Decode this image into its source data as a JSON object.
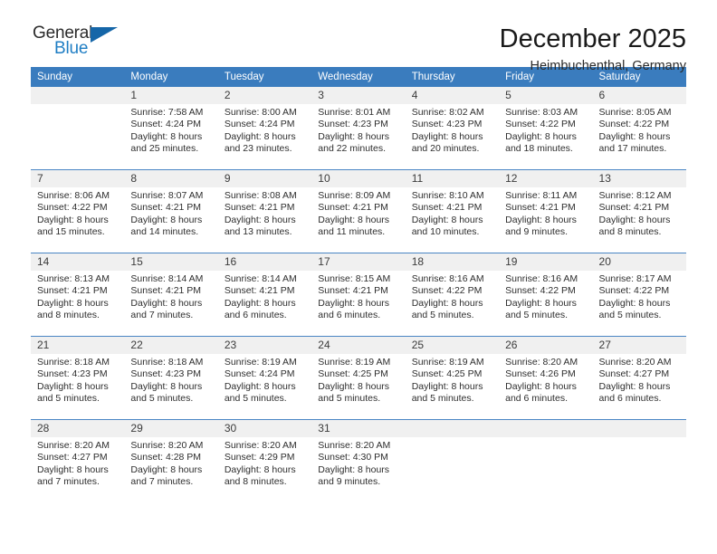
{
  "brand": {
    "name_primary": "General",
    "name_secondary": "Blue"
  },
  "header": {
    "title": "December 2025",
    "location": "Heimbuchenthal, Germany"
  },
  "colors": {
    "header_blue": "#3a7cbe",
    "logo_blue": "#1f7ec4",
    "row_divider": "#4a86c4",
    "daynum_band": "#f0f0f0"
  },
  "weekdays": [
    "Sunday",
    "Monday",
    "Tuesday",
    "Wednesday",
    "Thursday",
    "Friday",
    "Saturday"
  ],
  "weeks": [
    [
      {
        "day": "",
        "sunrise": "",
        "sunset": "",
        "daylight_1": "",
        "daylight_2": ""
      },
      {
        "day": "1",
        "sunrise": "Sunrise: 7:58 AM",
        "sunset": "Sunset: 4:24 PM",
        "daylight_1": "Daylight: 8 hours",
        "daylight_2": "and 25 minutes."
      },
      {
        "day": "2",
        "sunrise": "Sunrise: 8:00 AM",
        "sunset": "Sunset: 4:24 PM",
        "daylight_1": "Daylight: 8 hours",
        "daylight_2": "and 23 minutes."
      },
      {
        "day": "3",
        "sunrise": "Sunrise: 8:01 AM",
        "sunset": "Sunset: 4:23 PM",
        "daylight_1": "Daylight: 8 hours",
        "daylight_2": "and 22 minutes."
      },
      {
        "day": "4",
        "sunrise": "Sunrise: 8:02 AM",
        "sunset": "Sunset: 4:23 PM",
        "daylight_1": "Daylight: 8 hours",
        "daylight_2": "and 20 minutes."
      },
      {
        "day": "5",
        "sunrise": "Sunrise: 8:03 AM",
        "sunset": "Sunset: 4:22 PM",
        "daylight_1": "Daylight: 8 hours",
        "daylight_2": "and 18 minutes."
      },
      {
        "day": "6",
        "sunrise": "Sunrise: 8:05 AM",
        "sunset": "Sunset: 4:22 PM",
        "daylight_1": "Daylight: 8 hours",
        "daylight_2": "and 17 minutes."
      }
    ],
    [
      {
        "day": "7",
        "sunrise": "Sunrise: 8:06 AM",
        "sunset": "Sunset: 4:22 PM",
        "daylight_1": "Daylight: 8 hours",
        "daylight_2": "and 15 minutes."
      },
      {
        "day": "8",
        "sunrise": "Sunrise: 8:07 AM",
        "sunset": "Sunset: 4:21 PM",
        "daylight_1": "Daylight: 8 hours",
        "daylight_2": "and 14 minutes."
      },
      {
        "day": "9",
        "sunrise": "Sunrise: 8:08 AM",
        "sunset": "Sunset: 4:21 PM",
        "daylight_1": "Daylight: 8 hours",
        "daylight_2": "and 13 minutes."
      },
      {
        "day": "10",
        "sunrise": "Sunrise: 8:09 AM",
        "sunset": "Sunset: 4:21 PM",
        "daylight_1": "Daylight: 8 hours",
        "daylight_2": "and 11 minutes."
      },
      {
        "day": "11",
        "sunrise": "Sunrise: 8:10 AM",
        "sunset": "Sunset: 4:21 PM",
        "daylight_1": "Daylight: 8 hours",
        "daylight_2": "and 10 minutes."
      },
      {
        "day": "12",
        "sunrise": "Sunrise: 8:11 AM",
        "sunset": "Sunset: 4:21 PM",
        "daylight_1": "Daylight: 8 hours",
        "daylight_2": "and 9 minutes."
      },
      {
        "day": "13",
        "sunrise": "Sunrise: 8:12 AM",
        "sunset": "Sunset: 4:21 PM",
        "daylight_1": "Daylight: 8 hours",
        "daylight_2": "and 8 minutes."
      }
    ],
    [
      {
        "day": "14",
        "sunrise": "Sunrise: 8:13 AM",
        "sunset": "Sunset: 4:21 PM",
        "daylight_1": "Daylight: 8 hours",
        "daylight_2": "and 8 minutes."
      },
      {
        "day": "15",
        "sunrise": "Sunrise: 8:14 AM",
        "sunset": "Sunset: 4:21 PM",
        "daylight_1": "Daylight: 8 hours",
        "daylight_2": "and 7 minutes."
      },
      {
        "day": "16",
        "sunrise": "Sunrise: 8:14 AM",
        "sunset": "Sunset: 4:21 PM",
        "daylight_1": "Daylight: 8 hours",
        "daylight_2": "and 6 minutes."
      },
      {
        "day": "17",
        "sunrise": "Sunrise: 8:15 AM",
        "sunset": "Sunset: 4:21 PM",
        "daylight_1": "Daylight: 8 hours",
        "daylight_2": "and 6 minutes."
      },
      {
        "day": "18",
        "sunrise": "Sunrise: 8:16 AM",
        "sunset": "Sunset: 4:22 PM",
        "daylight_1": "Daylight: 8 hours",
        "daylight_2": "and 5 minutes."
      },
      {
        "day": "19",
        "sunrise": "Sunrise: 8:16 AM",
        "sunset": "Sunset: 4:22 PM",
        "daylight_1": "Daylight: 8 hours",
        "daylight_2": "and 5 minutes."
      },
      {
        "day": "20",
        "sunrise": "Sunrise: 8:17 AM",
        "sunset": "Sunset: 4:22 PM",
        "daylight_1": "Daylight: 8 hours",
        "daylight_2": "and 5 minutes."
      }
    ],
    [
      {
        "day": "21",
        "sunrise": "Sunrise: 8:18 AM",
        "sunset": "Sunset: 4:23 PM",
        "daylight_1": "Daylight: 8 hours",
        "daylight_2": "and 5 minutes."
      },
      {
        "day": "22",
        "sunrise": "Sunrise: 8:18 AM",
        "sunset": "Sunset: 4:23 PM",
        "daylight_1": "Daylight: 8 hours",
        "daylight_2": "and 5 minutes."
      },
      {
        "day": "23",
        "sunrise": "Sunrise: 8:19 AM",
        "sunset": "Sunset: 4:24 PM",
        "daylight_1": "Daylight: 8 hours",
        "daylight_2": "and 5 minutes."
      },
      {
        "day": "24",
        "sunrise": "Sunrise: 8:19 AM",
        "sunset": "Sunset: 4:25 PM",
        "daylight_1": "Daylight: 8 hours",
        "daylight_2": "and 5 minutes."
      },
      {
        "day": "25",
        "sunrise": "Sunrise: 8:19 AM",
        "sunset": "Sunset: 4:25 PM",
        "daylight_1": "Daylight: 8 hours",
        "daylight_2": "and 5 minutes."
      },
      {
        "day": "26",
        "sunrise": "Sunrise: 8:20 AM",
        "sunset": "Sunset: 4:26 PM",
        "daylight_1": "Daylight: 8 hours",
        "daylight_2": "and 6 minutes."
      },
      {
        "day": "27",
        "sunrise": "Sunrise: 8:20 AM",
        "sunset": "Sunset: 4:27 PM",
        "daylight_1": "Daylight: 8 hours",
        "daylight_2": "and 6 minutes."
      }
    ],
    [
      {
        "day": "28",
        "sunrise": "Sunrise: 8:20 AM",
        "sunset": "Sunset: 4:27 PM",
        "daylight_1": "Daylight: 8 hours",
        "daylight_2": "and 7 minutes."
      },
      {
        "day": "29",
        "sunrise": "Sunrise: 8:20 AM",
        "sunset": "Sunset: 4:28 PM",
        "daylight_1": "Daylight: 8 hours",
        "daylight_2": "and 7 minutes."
      },
      {
        "day": "30",
        "sunrise": "Sunrise: 8:20 AM",
        "sunset": "Sunset: 4:29 PM",
        "daylight_1": "Daylight: 8 hours",
        "daylight_2": "and 8 minutes."
      },
      {
        "day": "31",
        "sunrise": "Sunrise: 8:20 AM",
        "sunset": "Sunset: 4:30 PM",
        "daylight_1": "Daylight: 8 hours",
        "daylight_2": "and 9 minutes."
      },
      {
        "day": "",
        "sunrise": "",
        "sunset": "",
        "daylight_1": "",
        "daylight_2": ""
      },
      {
        "day": "",
        "sunrise": "",
        "sunset": "",
        "daylight_1": "",
        "daylight_2": ""
      },
      {
        "day": "",
        "sunrise": "",
        "sunset": "",
        "daylight_1": "",
        "daylight_2": ""
      }
    ]
  ]
}
